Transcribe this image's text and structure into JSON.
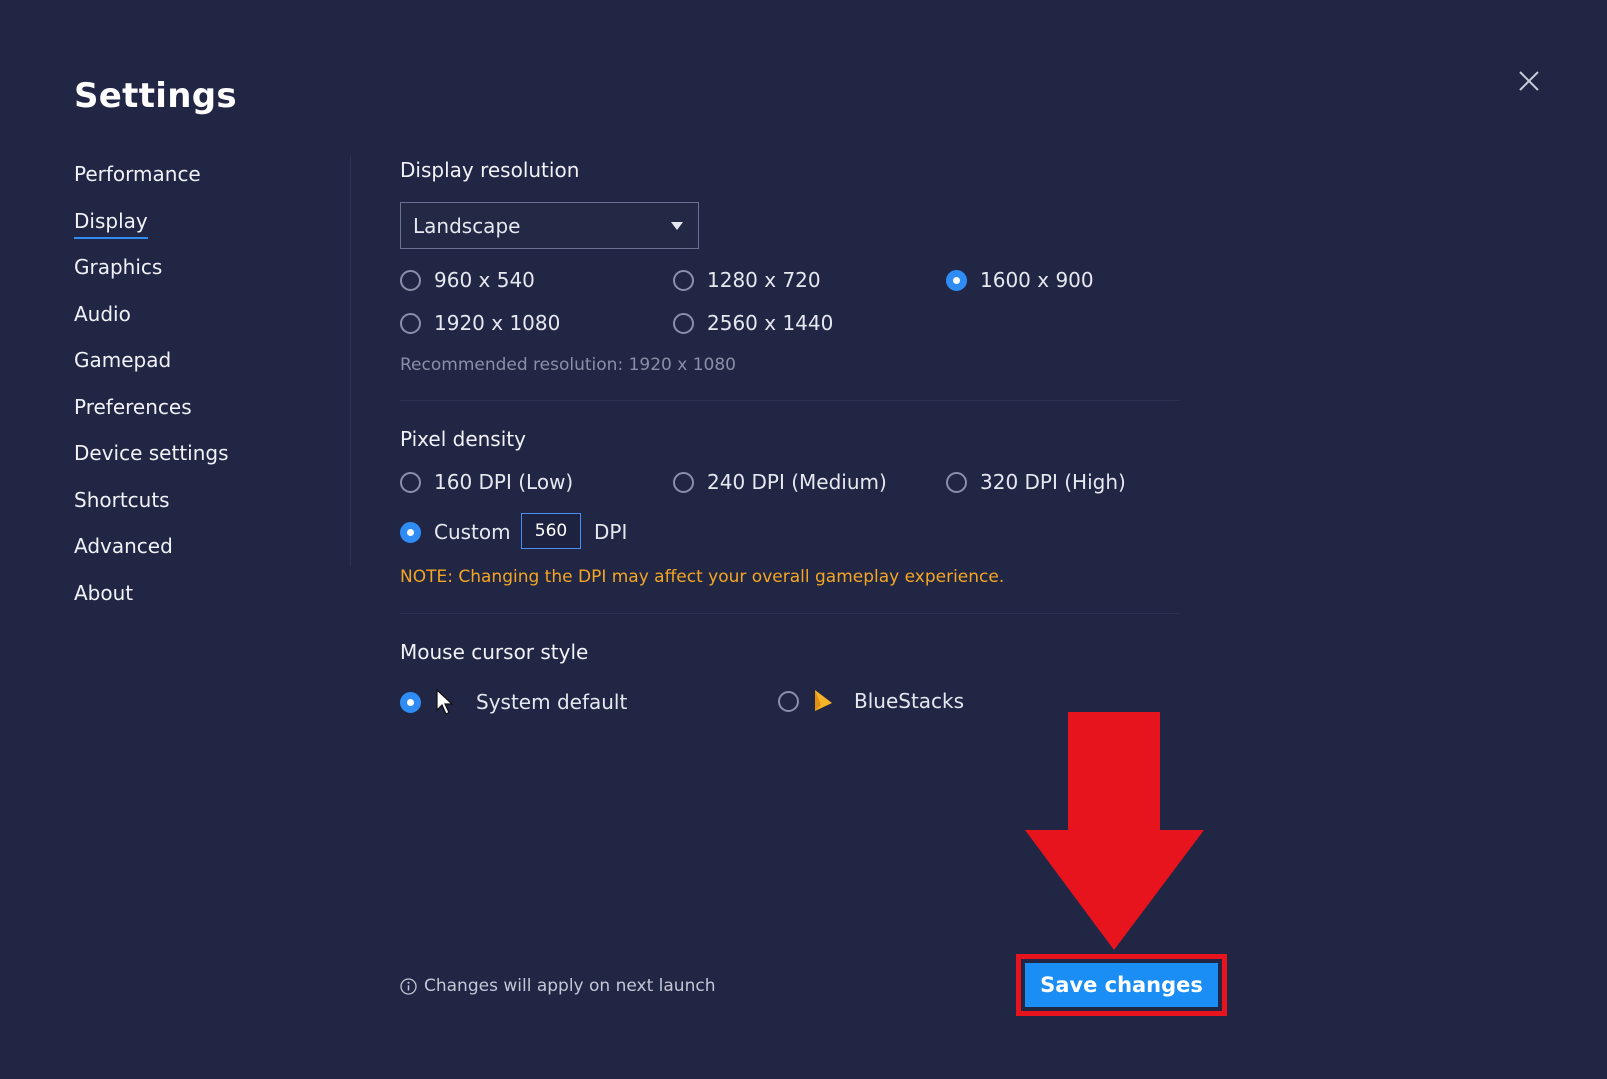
{
  "window": {
    "title": "Settings"
  },
  "sidebar": {
    "items": [
      {
        "label": "Performance"
      },
      {
        "label": "Display",
        "active": true
      },
      {
        "label": "Graphics"
      },
      {
        "label": "Audio"
      },
      {
        "label": "Gamepad"
      },
      {
        "label": "Preferences"
      },
      {
        "label": "Device settings"
      },
      {
        "label": "Shortcuts"
      },
      {
        "label": "Advanced"
      },
      {
        "label": "About"
      }
    ]
  },
  "display_resolution": {
    "title": "Display resolution",
    "orientation": {
      "selected": "Landscape"
    },
    "options": [
      {
        "label": "960 x 540",
        "checked": false
      },
      {
        "label": "1280 x 720",
        "checked": false
      },
      {
        "label": "1600 x 900",
        "checked": true
      },
      {
        "label": "1920 x 1080",
        "checked": false
      },
      {
        "label": "2560 x 1440",
        "checked": false
      }
    ],
    "recommended": "Recommended resolution: 1920 x 1080"
  },
  "pixel_density": {
    "title": "Pixel density",
    "options": [
      {
        "label": "160 DPI (Low)",
        "checked": false
      },
      {
        "label": "240 DPI (Medium)",
        "checked": false
      },
      {
        "label": "320 DPI (High)",
        "checked": false
      },
      {
        "label": "Custom",
        "checked": true
      }
    ],
    "custom_value": "560",
    "unit": "DPI",
    "note": "NOTE: Changing the DPI may affect your overall gameplay experience."
  },
  "mouse_cursor": {
    "title": "Mouse cursor style",
    "options": [
      {
        "label": "System default",
        "checked": true,
        "icon": "arrow-cursor-icon"
      },
      {
        "label": "BlueStacks",
        "checked": false,
        "icon": "bluestacks-cursor-icon"
      }
    ]
  },
  "footer": {
    "info": "Changes will apply on next launch",
    "save_label": "Save changes"
  },
  "colors": {
    "background": "#212644",
    "accent": "#2f8cf5",
    "save_button": "#1a8ef5",
    "note": "#f4a623",
    "annotation_red": "#e8141d"
  }
}
